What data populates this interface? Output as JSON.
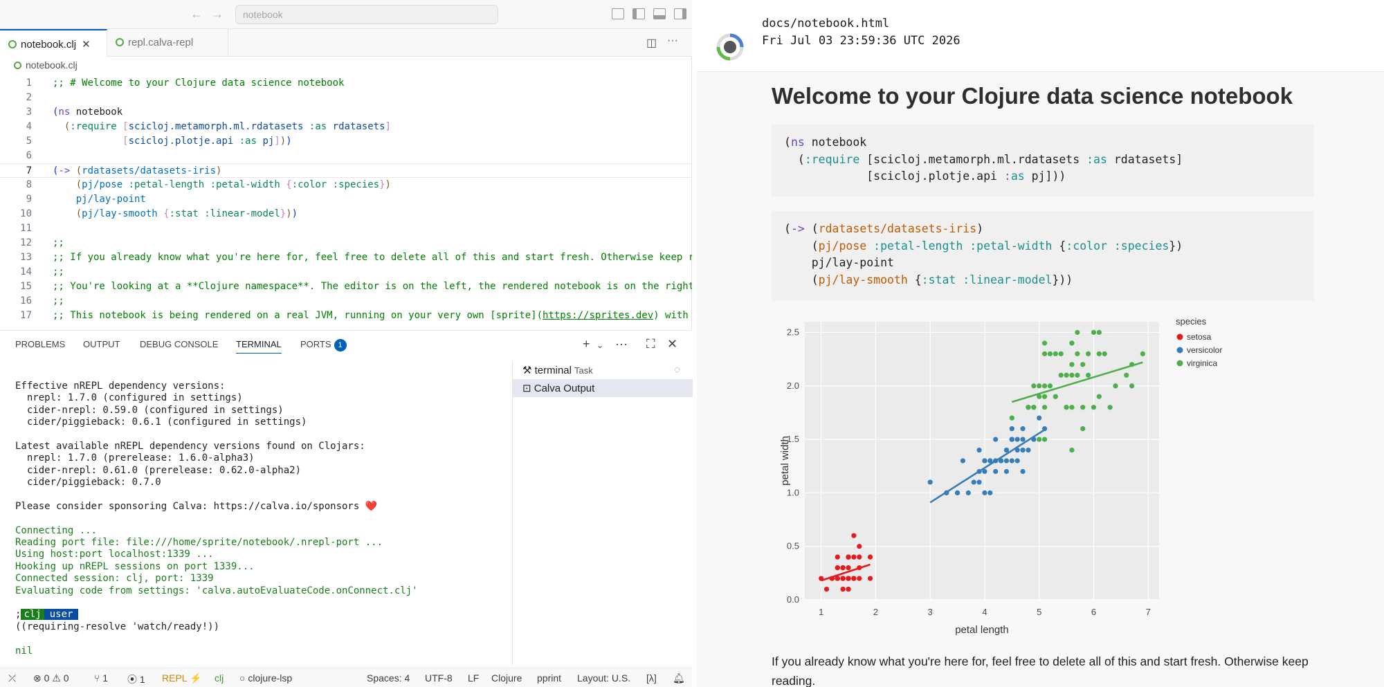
{
  "titlebar": {
    "command_center": "notebook"
  },
  "tabs": [
    {
      "label": "notebook.clj",
      "active": true
    },
    {
      "label": "repl.calva-repl",
      "active": false
    }
  ],
  "breadcrumb": "notebook.clj",
  "code_lines": [
    {
      "n": "1",
      "html": "<span class='c-com'>;; # Welcome to your Clojure data science notebook</span>"
    },
    {
      "n": "2",
      "html": ""
    },
    {
      "n": "3",
      "html": "<span class='c-br1'>(</span><span class='c-kw'>ns</span> notebook"
    },
    {
      "n": "4",
      "html": "  <span class='c-br2'>(</span><span class='c-teal'>:require</span> <span class='c-br3'>[</span><span class='c-blue'>scicloj.metamorph.ml.rdatasets</span> <span class='c-teal'>:as</span> <span class='c-blue'>rdatasets</span><span class='c-br3'>]</span>"
    },
    {
      "n": "5",
      "html": "            <span class='c-br3'>[</span><span class='c-blue'>scicloj.plotje.api</span> <span class='c-teal'>:as</span> <span class='c-blue'>pj</span><span class='c-br3'>]</span><span class='c-br2'>)</span><span class='c-br1'>)</span>"
    },
    {
      "n": "6",
      "html": ""
    },
    {
      "n": "7",
      "html": "<span class='c-br1'>(</span><span class='c-kw'>-&gt;</span> <span class='c-br2'>(</span><span class='c-fn'>rdatasets/datasets-iris</span><span class='c-br2'>)</span>"
    },
    {
      "n": "8",
      "html": "    <span class='c-br2'>(</span><span class='c-fn'>pj/pose</span> <span class='c-teal'>:petal-length</span> <span class='c-teal'>:petal-width</span> <span class='c-br3'>{</span><span class='c-teal'>:color</span> <span class='c-teal'>:species</span><span class='c-br3'>}</span><span class='c-br2'>)</span>"
    },
    {
      "n": "9",
      "html": "    <span class='c-fn'>pj/lay-point</span>"
    },
    {
      "n": "10",
      "html": "    <span class='c-br2'>(</span><span class='c-fn'>pj/lay-smooth</span> <span class='c-br3'>{</span><span class='c-teal'>:stat</span> <span class='c-teal'>:linear-model</span><span class='c-br3'>}</span><span class='c-br2'>)</span><span class='c-br1'>)</span>"
    },
    {
      "n": "11",
      "html": ""
    },
    {
      "n": "12",
      "html": "<span class='c-com'>;;</span>"
    },
    {
      "n": "13",
      "html": "<span class='c-com'>;; If you already know what you're here for, feel free to delete all of this and start fresh. Otherwise keep r</span>"
    },
    {
      "n": "14",
      "html": "<span class='c-com'>;;</span>"
    },
    {
      "n": "15",
      "html": "<span class='c-com'>;; You're looking at a **Clojure namespace**. The editor is on the left, the rendered notebook is on the right</span>"
    },
    {
      "n": "16",
      "html": "<span class='c-com'>;;</span>"
    },
    {
      "n": "17",
      "html": "<span class='c-com'>;; This notebook is being rendered on a real JVM, running on your very own [sprite](<u>https://sprites.dev</u>) with</span>"
    },
    {
      "n": "18",
      "html": "<span class='c-com'>;;</span>"
    }
  ],
  "panel": {
    "tabs": [
      "PROBLEMS",
      "OUTPUT",
      "DEBUG CONSOLE",
      "TERMINAL",
      "PORTS"
    ],
    "ports_badge": "1",
    "terminal_list": [
      {
        "label": "terminal",
        "sub": "Task"
      },
      {
        "label": "Calva Output",
        "sub": ""
      }
    ]
  },
  "terminal_lines": [
    {
      "t": "Effective nREPL dependency versions:",
      "c": "dark"
    },
    {
      "t": "  nrepl: 1.7.0 (configured in settings)",
      "c": "dark"
    },
    {
      "t": "  cider-nrepl: 0.59.0 (configured in settings)",
      "c": "dark"
    },
    {
      "t": "  cider/piggieback: 0.6.1 (configured in settings)",
      "c": "dark"
    },
    {
      "t": "",
      "c": "dark"
    },
    {
      "t": "Latest available nREPL dependency versions found on Clojars:",
      "c": "dark"
    },
    {
      "t": "  nrepl: 1.7.0 (prerelease: 1.6.0-alpha3)",
      "c": "dark"
    },
    {
      "t": "  cider-nrepl: 0.61.0 (prerelease: 0.62.0-alpha2)",
      "c": "dark"
    },
    {
      "t": "  cider/piggieback: 0.7.0",
      "c": "dark"
    },
    {
      "t": "",
      "c": "dark"
    },
    {
      "t": "Please consider sponsoring Calva: https://calva.io/sponsors ❤️",
      "c": "dark"
    },
    {
      "t": "",
      "c": "dark"
    },
    {
      "t": "Connecting ...",
      "c": "green"
    },
    {
      "t": "Reading port file: file:///home/sprite/notebook/.nrepl-port ...",
      "c": "green"
    },
    {
      "t": "Using host:port localhost:1339 ...",
      "c": "green"
    },
    {
      "t": "Hooking up nREPL sessions on port 1339...",
      "c": "green"
    },
    {
      "t": "Connected session: clj, port: 1339",
      "c": "green"
    },
    {
      "t": "Evaluating code from settings: 'calva.autoEvaluateCode.onConnect.clj'",
      "c": "green"
    },
    {
      "t": "",
      "c": "dark"
    },
    {
      "t": "",
      "c": "prompt"
    },
    {
      "t": "((requiring-resolve 'watch/ready!))",
      "c": "dark"
    },
    {
      "t": "",
      "c": "dark"
    },
    {
      "t": "nil",
      "c": "green"
    }
  ],
  "prompt": {
    "prefix": ";",
    "ns1": "clj",
    "ns2": "user"
  },
  "statusbar": {
    "errors": "0",
    "warnings": "0",
    "git": "1",
    "ports": "1",
    "repl": "REPL",
    "lang_tag": "clj",
    "lsp": "clojure-lsp",
    "spaces": "Spaces: 4",
    "encoding": "UTF-8",
    "eol": "LF",
    "language": "Clojure",
    "pprint": "pprint",
    "layout": "Layout: U.S.",
    "lambda": "[λ]"
  },
  "notebook": {
    "path": "docs/notebook.html",
    "date": "Fri Jul 03 23:59:36 UTC 2026",
    "title": "Welcome to your Clojure data science notebook",
    "paragraph": "If you already know what you're here for, feel free to delete all of this and start fresh. Otherwise keep reading."
  },
  "chart_data": {
    "type": "scatter",
    "xlabel": "petal length",
    "ylabel": "petal width",
    "xlim": [
      0.7,
      7.2
    ],
    "ylim": [
      0,
      2.6
    ],
    "xticks": [
      1,
      2,
      3,
      4,
      5,
      6,
      7
    ],
    "yticks": [
      0.0,
      0.5,
      1.0,
      1.5,
      2.0,
      2.5
    ],
    "legend_title": "species",
    "legend_position": "top-right",
    "series": [
      {
        "name": "setosa",
        "color": "#e41a1c",
        "points": [
          [
            1.4,
            0.2
          ],
          [
            1.4,
            0.2
          ],
          [
            1.3,
            0.2
          ],
          [
            1.5,
            0.2
          ],
          [
            1.4,
            0.2
          ],
          [
            1.7,
            0.4
          ],
          [
            1.4,
            0.3
          ],
          [
            1.5,
            0.2
          ],
          [
            1.4,
            0.2
          ],
          [
            1.5,
            0.1
          ],
          [
            1.5,
            0.2
          ],
          [
            1.6,
            0.2
          ],
          [
            1.4,
            0.1
          ],
          [
            1.1,
            0.1
          ],
          [
            1.2,
            0.2
          ],
          [
            1.5,
            0.4
          ],
          [
            1.3,
            0.4
          ],
          [
            1.4,
            0.3
          ],
          [
            1.7,
            0.3
          ],
          [
            1.5,
            0.3
          ],
          [
            1.7,
            0.2
          ],
          [
            1.5,
            0.4
          ],
          [
            1.0,
            0.2
          ],
          [
            1.7,
            0.5
          ],
          [
            1.9,
            0.2
          ],
          [
            1.6,
            0.2
          ],
          [
            1.6,
            0.4
          ],
          [
            1.5,
            0.2
          ],
          [
            1.4,
            0.2
          ],
          [
            1.6,
            0.2
          ],
          [
            1.6,
            0.2
          ],
          [
            1.5,
            0.4
          ],
          [
            1.5,
            0.1
          ],
          [
            1.4,
            0.2
          ],
          [
            1.5,
            0.2
          ],
          [
            1.2,
            0.2
          ],
          [
            1.3,
            0.2
          ],
          [
            1.4,
            0.1
          ],
          [
            1.3,
            0.2
          ],
          [
            1.5,
            0.2
          ],
          [
            1.3,
            0.3
          ],
          [
            1.3,
            0.3
          ],
          [
            1.3,
            0.2
          ],
          [
            1.6,
            0.6
          ],
          [
            1.9,
            0.4
          ],
          [
            1.4,
            0.3
          ],
          [
            1.6,
            0.2
          ],
          [
            1.4,
            0.2
          ],
          [
            1.5,
            0.2
          ],
          [
            1.4,
            0.2
          ]
        ],
        "fit": [
          [
            1.0,
            0.18
          ],
          [
            1.9,
            0.33
          ]
        ]
      },
      {
        "name": "versicolor",
        "color": "#377eb8",
        "points": [
          [
            4.7,
            1.4
          ],
          [
            4.5,
            1.5
          ],
          [
            4.9,
            1.5
          ],
          [
            4.0,
            1.3
          ],
          [
            4.6,
            1.5
          ],
          [
            4.5,
            1.3
          ],
          [
            4.7,
            1.6
          ],
          [
            3.3,
            1.0
          ],
          [
            4.6,
            1.3
          ],
          [
            3.9,
            1.4
          ],
          [
            3.5,
            1.0
          ],
          [
            4.2,
            1.5
          ],
          [
            4.0,
            1.0
          ],
          [
            4.7,
            1.4
          ],
          [
            3.6,
            1.3
          ],
          [
            4.4,
            1.4
          ],
          [
            4.5,
            1.5
          ],
          [
            4.1,
            1.0
          ],
          [
            4.5,
            1.5
          ],
          [
            3.9,
            1.1
          ],
          [
            4.8,
            1.8
          ],
          [
            4.0,
            1.3
          ],
          [
            4.9,
            1.5
          ],
          [
            4.7,
            1.2
          ],
          [
            4.3,
            1.3
          ],
          [
            4.4,
            1.4
          ],
          [
            4.8,
            1.4
          ],
          [
            5.0,
            1.7
          ],
          [
            4.5,
            1.5
          ],
          [
            3.5,
            1.0
          ],
          [
            3.8,
            1.1
          ],
          [
            3.7,
            1.0
          ],
          [
            3.9,
            1.2
          ],
          [
            5.1,
            1.6
          ],
          [
            4.5,
            1.5
          ],
          [
            4.5,
            1.6
          ],
          [
            4.7,
            1.5
          ],
          [
            4.4,
            1.3
          ],
          [
            4.1,
            1.3
          ],
          [
            4.0,
            1.3
          ],
          [
            4.4,
            1.2
          ],
          [
            4.6,
            1.4
          ],
          [
            4.0,
            1.2
          ],
          [
            3.3,
            1.0
          ],
          [
            4.2,
            1.3
          ],
          [
            4.2,
            1.2
          ],
          [
            4.2,
            1.3
          ],
          [
            4.3,
            1.3
          ],
          [
            3.0,
            1.1
          ],
          [
            4.1,
            1.3
          ]
        ],
        "fit": [
          [
            3.0,
            0.91
          ],
          [
            5.1,
            1.59
          ]
        ]
      },
      {
        "name": "virginica",
        "color": "#4daf4a",
        "points": [
          [
            6.0,
            2.5
          ],
          [
            5.1,
            1.9
          ],
          [
            5.9,
            2.1
          ],
          [
            5.6,
            1.8
          ],
          [
            5.8,
            2.2
          ],
          [
            6.6,
            2.1
          ],
          [
            4.5,
            1.7
          ],
          [
            6.3,
            1.8
          ],
          [
            5.8,
            1.8
          ],
          [
            6.1,
            2.5
          ],
          [
            5.1,
            2.0
          ],
          [
            5.3,
            1.9
          ],
          [
            5.5,
            2.1
          ],
          [
            5.0,
            2.0
          ],
          [
            5.1,
            2.4
          ],
          [
            5.3,
            2.3
          ],
          [
            5.5,
            1.8
          ],
          [
            6.7,
            2.2
          ],
          [
            6.9,
            2.3
          ],
          [
            5.0,
            1.5
          ],
          [
            5.7,
            2.3
          ],
          [
            4.9,
            2.0
          ],
          [
            6.7,
            2.0
          ],
          [
            4.9,
            1.8
          ],
          [
            5.7,
            2.1
          ],
          [
            6.0,
            1.8
          ],
          [
            4.8,
            1.8
          ],
          [
            4.9,
            1.8
          ],
          [
            5.6,
            2.1
          ],
          [
            5.8,
            1.6
          ],
          [
            6.1,
            1.9
          ],
          [
            6.4,
            2.0
          ],
          [
            5.6,
            2.2
          ],
          [
            5.1,
            1.5
          ],
          [
            5.6,
            1.4
          ],
          [
            6.1,
            2.3
          ],
          [
            5.6,
            2.4
          ],
          [
            5.5,
            1.8
          ],
          [
            4.8,
            1.8
          ],
          [
            5.4,
            2.1
          ],
          [
            5.6,
            2.4
          ],
          [
            5.1,
            2.3
          ],
          [
            5.9,
            2.3
          ],
          [
            5.7,
            2.5
          ],
          [
            5.2,
            2.3
          ],
          [
            5.0,
            1.9
          ],
          [
            5.2,
            2.0
          ],
          [
            5.4,
            2.3
          ],
          [
            5.1,
            1.8
          ],
          [
            6.2,
            2.3
          ]
        ],
        "fit": [
          [
            4.5,
            1.85
          ],
          [
            6.9,
            2.22
          ]
        ]
      }
    ]
  }
}
